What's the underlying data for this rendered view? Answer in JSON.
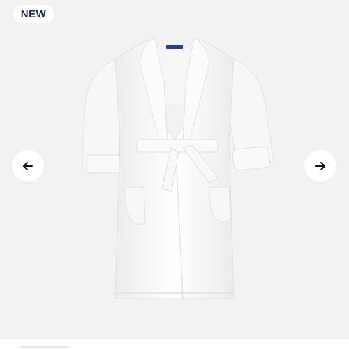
{
  "gallery": {
    "badge": "NEW",
    "product_icon": "white-bathrobe-image",
    "prev_icon": "arrow-left-icon",
    "next_icon": "arrow-right-icon"
  },
  "colors": {
    "background": "#f2f2f2",
    "badge_text": "#1f2b4d",
    "robe_label": "#2b3f86"
  }
}
